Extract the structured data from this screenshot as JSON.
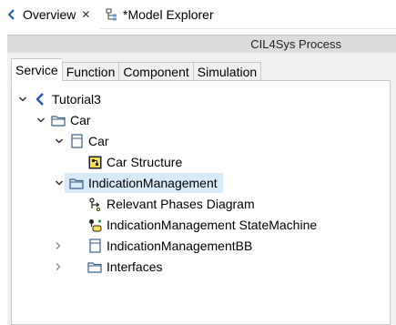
{
  "view_tabs": [
    {
      "label": "Overview",
      "icon": "overview-icon",
      "active": true
    },
    {
      "label": "*Model Explorer",
      "icon": "model-explorer-icon",
      "active": false
    }
  ],
  "process_header": {
    "title": "CIL4Sys Process"
  },
  "inner_tabs": [
    "Service",
    "Function",
    "Component",
    "Simulation"
  ],
  "tree": [
    {
      "label": "Tutorial3",
      "icon": "model-icon",
      "twisty": "expanded",
      "depth": 0
    },
    {
      "label": "Car",
      "icon": "package-icon",
      "twisty": "expanded",
      "depth": 1
    },
    {
      "label": "Car",
      "icon": "block-icon",
      "twisty": "expanded",
      "depth": 2
    },
    {
      "label": "Car Structure",
      "icon": "structure-diagram-icon",
      "twisty": "none",
      "depth": 3
    },
    {
      "label": "IndicationManagement",
      "icon": "package-icon",
      "twisty": "expanded",
      "depth": 1,
      "selected": true
    },
    {
      "label": "Relevant Phases Diagram",
      "icon": "phases-diagram-icon",
      "twisty": "none",
      "depth": 2
    },
    {
      "label": "IndicationManagement StateMachine",
      "icon": "state-machine-icon",
      "twisty": "none",
      "depth": 2
    },
    {
      "label": "IndicationManagementBB",
      "icon": "block-icon",
      "twisty": "collapsed",
      "depth": 2
    },
    {
      "label": "Interfaces",
      "icon": "package-icon",
      "twisty": "collapsed",
      "depth": 2
    }
  ],
  "colors": {
    "selection": "#d9eaf7",
    "accent": "#2a5db0",
    "header_band": "#dcdcdc"
  }
}
